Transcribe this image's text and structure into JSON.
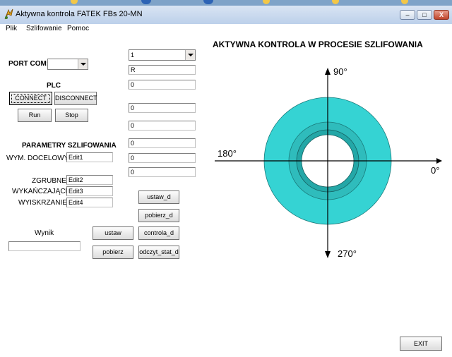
{
  "window": {
    "title": "Aktywna kontrola FATEK FBs 20-MN",
    "minimize_label": "–",
    "maximize_label": "□",
    "close_label": "X"
  },
  "menu": {
    "items": [
      "Plik",
      "Szlifowanie",
      "Pomoc"
    ]
  },
  "left": {
    "port_label": "PORT COM:",
    "port_value": "",
    "plc_label": "PLC",
    "connect_label": "CONNECT",
    "disconnect_label": "DISCONNECT",
    "run_label": "Run",
    "stop_label": "Stop",
    "params_label": "PARAMETRY SZLIFOWANIA",
    "target_label": "WYM. DOCELOWY:",
    "target_value": "Edit1",
    "rough_label": "ZGRUBNE:",
    "rough_value": "Edit2",
    "finish_label": "WYKAŃCZAJĄCE:",
    "finish_value": "Edit3",
    "sparkout_label": "WYISKRZANIE:",
    "sparkout_value": "Edit4",
    "result_label": "Wynik",
    "result_value": ""
  },
  "middle": {
    "combo_value": "1",
    "field_r": "R",
    "fields": [
      "0",
      "0",
      "0",
      "0",
      "0",
      "0"
    ],
    "set_d_label": "ustaw_d",
    "get_d_label": "pobierz_d",
    "set_label": "ustaw",
    "control_d_label": "controla_d",
    "get_label": "pobierz",
    "read_stat_label": "odczyt_stat_d"
  },
  "diagram": {
    "title": "AKTYWNA KONTROLA W PROCESIE SZLIFOWANIA",
    "angle_top": "90°",
    "angle_left": "180°",
    "angle_right": "0°",
    "angle_bottom": "270°",
    "outer_color": "#35d3d3",
    "inner_color": "#24a7a7",
    "inner_band_color": "#2fbcbc"
  },
  "footer": {
    "exit_label": "EXIT"
  }
}
